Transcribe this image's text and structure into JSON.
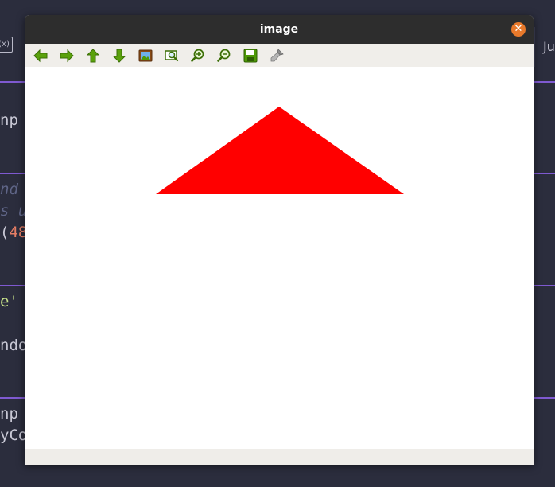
{
  "window": {
    "title": "image"
  },
  "toolbar": {
    "tools": [
      {
        "name": "pan-left",
        "icon": "arrow-left-icon"
      },
      {
        "name": "pan-right",
        "icon": "arrow-right-icon"
      },
      {
        "name": "pan-up",
        "icon": "arrow-up-icon"
      },
      {
        "name": "pan-down",
        "icon": "arrow-down-icon"
      },
      {
        "name": "zoom-fit",
        "icon": "image-fit-icon"
      },
      {
        "name": "zoom-original",
        "icon": "zoom-original-icon"
      },
      {
        "name": "zoom-in",
        "icon": "zoom-in-icon"
      },
      {
        "name": "zoom-out",
        "icon": "zoom-out-icon"
      },
      {
        "name": "save",
        "icon": "save-icon"
      },
      {
        "name": "properties",
        "icon": "brush-icon"
      }
    ]
  },
  "canvas": {
    "shape": "triangle",
    "fill_color": "#ff0000",
    "background_color": "#ffffff"
  },
  "background_editor": {
    "left_icon_label": "(x)",
    "right_tab_label": "Ju",
    "lines": {
      "l1": "np",
      "l2": "nd",
      "l3": "s u",
      "l4_paren": "(",
      "l4_num": "48",
      "l5": "e'",
      "l6": "ndo",
      "l7": "np",
      "l8": "yCo"
    }
  },
  "colors": {
    "editor_bg": "#2b2d3d",
    "cell_separator": "#7f5ad1",
    "titlebar_bg": "#2d2d2d",
    "close_button": "#e8792b",
    "toolbar_bg": "#f0eeea",
    "icon_green": "#4e9a06"
  }
}
